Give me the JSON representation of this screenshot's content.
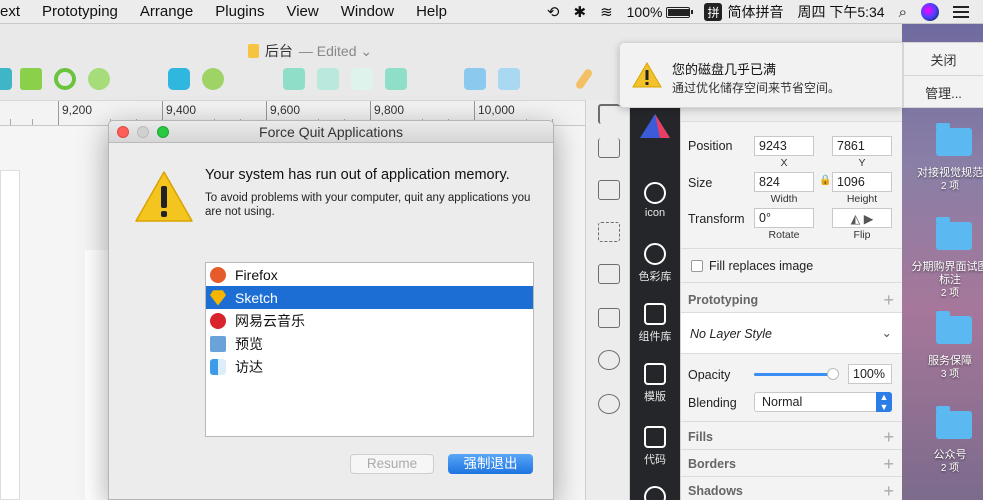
{
  "menubar": {
    "items": [
      "ext",
      "Prototyping",
      "Arrange",
      "Plugins",
      "View",
      "Window",
      "Help"
    ],
    "battery": "100%",
    "ime": "简体拼音",
    "ime_glyph": "拼",
    "clock": "周四 下午5:34"
  },
  "sketch": {
    "doc_title": "后台",
    "doc_state": "— Edited ⌄",
    "ruler": [
      "9,200",
      "9,400",
      "9,600",
      "9,800",
      "10,000"
    ]
  },
  "plugin_bar": {
    "items": [
      "icon",
      "色彩库",
      "组件库",
      "模版",
      "代码"
    ]
  },
  "inspector": {
    "position_label": "Position",
    "x_value": "9243",
    "y_value": "7861",
    "x_label": "X",
    "y_label": "Y",
    "size_label": "Size",
    "width_value": "824",
    "height_value": "1096",
    "width_label": "Width",
    "height_label": "Height",
    "transform_label": "Transform",
    "rotate_value": "0°",
    "rotate_label": "Rotate",
    "flip_label": "Flip",
    "fill_replaces": "Fill replaces image",
    "prototyping": "Prototyping",
    "layer_style": "No Layer Style",
    "opacity_label": "Opacity",
    "opacity_value": "100%",
    "opacity_level": 1.0,
    "blending_label": "Blending",
    "blending_value": "Normal",
    "fills": "Fills",
    "borders": "Borders",
    "shadows": "Shadows"
  },
  "notification": {
    "title": "您的磁盘几乎已满",
    "body": "通过优化储存空间来节省空间。",
    "close": "关闭",
    "manage": "管理..."
  },
  "desktop": {
    "folders": [
      {
        "label": "对接视觉规范",
        "count": "2 项"
      },
      {
        "label": "分期购界面试图标注",
        "count": "2 项"
      },
      {
        "label": "服务保障",
        "count": "3 项"
      },
      {
        "label": "公众号",
        "count": "2 项"
      }
    ]
  },
  "dialog": {
    "title": "Force Quit Applications",
    "heading": "Your system has run out of application memory.",
    "body": "To avoid problems with your computer, quit any applications you are not using.",
    "apps": [
      {
        "name": "Firefox",
        "color": "#e55b2b"
      },
      {
        "name": "Sketch",
        "color": "#f7b500"
      },
      {
        "name": "网易云音乐",
        "color": "#d9232d"
      },
      {
        "name": "预览",
        "color": "#6aa3d8"
      },
      {
        "name": "访达",
        "color": "#3d9be9"
      }
    ],
    "selected_index": 1,
    "resume": "Resume",
    "force_quit": "强制退出"
  }
}
